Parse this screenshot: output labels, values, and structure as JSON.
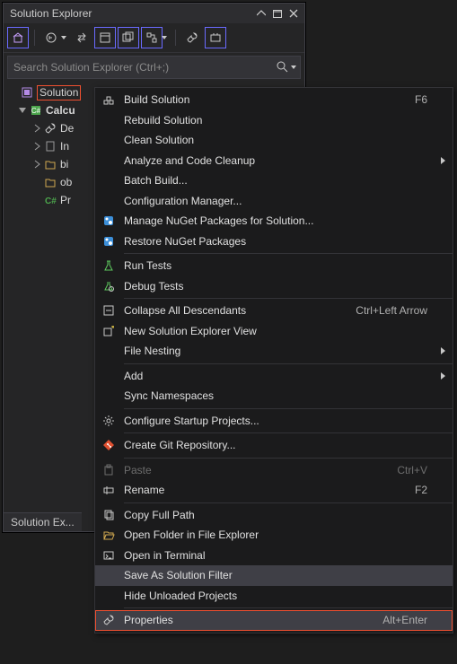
{
  "panel": {
    "title": "Solution Explorer",
    "footer_tab": "Solution Ex..."
  },
  "search": {
    "placeholder": "Search Solution Explorer (Ctrl+;)"
  },
  "tree": {
    "solution_label": "Solution",
    "project_label": "Calcu",
    "nodes": [
      {
        "label": "De"
      },
      {
        "label": "In"
      },
      {
        "label": "bi"
      },
      {
        "label": "ob"
      },
      {
        "label": "Pr"
      }
    ]
  },
  "menu": {
    "items": [
      {
        "id": "build",
        "label": "Build Solution",
        "shortcut": "F6",
        "icon": "build"
      },
      {
        "id": "rebuild",
        "label": "Rebuild Solution",
        "icon": ""
      },
      {
        "id": "clean",
        "label": "Clean Solution",
        "icon": ""
      },
      {
        "id": "analyze",
        "label": "Analyze and Code Cleanup",
        "icon": "",
        "submenu": true
      },
      {
        "id": "batch",
        "label": "Batch Build...",
        "icon": ""
      },
      {
        "id": "cfgmgr",
        "label": "Configuration Manager...",
        "icon": ""
      },
      {
        "id": "nuget",
        "label": "Manage NuGet Packages for Solution...",
        "icon": "nuget"
      },
      {
        "id": "nugetrestore",
        "label": "Restore NuGet Packages",
        "icon": "nuget"
      },
      {
        "sep": true
      },
      {
        "id": "runtests",
        "label": "Run Tests",
        "icon": "flask"
      },
      {
        "id": "debugtests",
        "label": "Debug Tests",
        "icon": "flask-bug"
      },
      {
        "sep": true
      },
      {
        "id": "collapse",
        "label": "Collapse All Descendants",
        "shortcut": "Ctrl+Left Arrow",
        "icon": "collapse"
      },
      {
        "id": "newview",
        "label": "New Solution Explorer View",
        "icon": "newview"
      },
      {
        "id": "nesting",
        "label": "File Nesting",
        "icon": "",
        "submenu": true
      },
      {
        "sep": true
      },
      {
        "id": "add",
        "label": "Add",
        "icon": "",
        "submenu": true
      },
      {
        "id": "syncns",
        "label": "Sync Namespaces",
        "icon": ""
      },
      {
        "sep": true
      },
      {
        "id": "startup",
        "label": "Configure Startup Projects...",
        "icon": "gear"
      },
      {
        "sep": true
      },
      {
        "id": "git",
        "label": "Create Git Repository...",
        "icon": "git"
      },
      {
        "sep": true
      },
      {
        "id": "paste",
        "label": "Paste",
        "shortcut": "Ctrl+V",
        "icon": "paste",
        "disabled": true
      },
      {
        "id": "rename",
        "label": "Rename",
        "shortcut": "F2",
        "icon": "rename"
      },
      {
        "sep": true
      },
      {
        "id": "copypath",
        "label": "Copy Full Path",
        "icon": "copy"
      },
      {
        "id": "openfolder",
        "label": "Open Folder in File Explorer",
        "icon": "folder-open"
      },
      {
        "id": "terminal",
        "label": "Open in Terminal",
        "icon": "terminal"
      },
      {
        "id": "savefilter",
        "label": "Save As Solution Filter",
        "icon": "",
        "hover": true
      },
      {
        "id": "hideunloaded",
        "label": "Hide Unloaded Projects",
        "icon": ""
      },
      {
        "sep": true
      },
      {
        "id": "properties",
        "label": "Properties",
        "shortcut": "Alt+Enter",
        "icon": "wrench",
        "redhl": true
      }
    ]
  }
}
